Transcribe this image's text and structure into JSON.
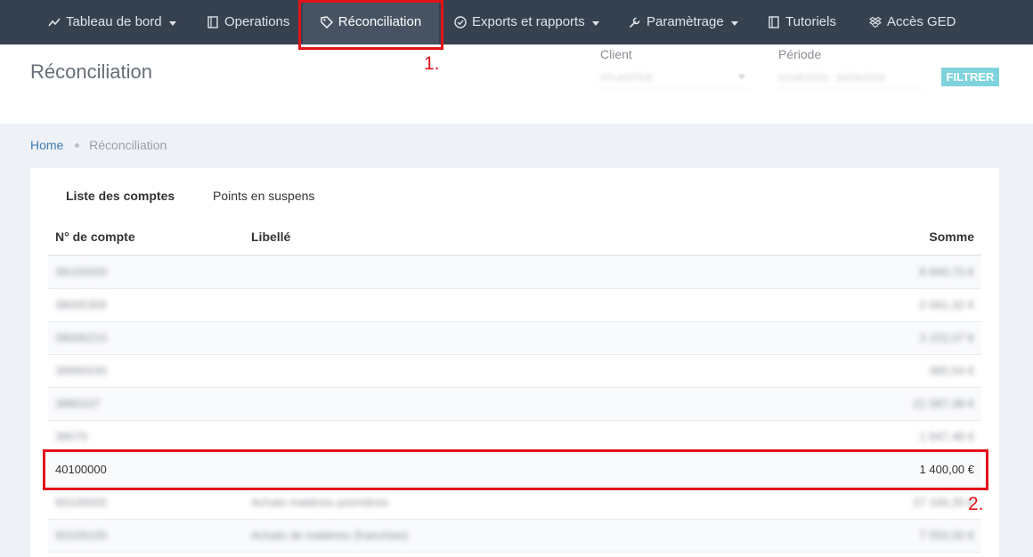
{
  "nav": {
    "items": [
      {
        "label": "Tableau de bord",
        "icon": "chart-line-icon",
        "caret": true
      },
      {
        "label": "Operations",
        "icon": "book-icon",
        "caret": false
      },
      {
        "label": "Réconciliation",
        "icon": "tag-icon",
        "caret": false,
        "active": true
      },
      {
        "label": "Exports et rapports",
        "icon": "check-circle-icon",
        "caret": true
      },
      {
        "label": "Paramètrage",
        "icon": "wrench-icon",
        "caret": true
      },
      {
        "label": "Tutoriels",
        "icon": "book-icon",
        "caret": false
      },
      {
        "label": "Accès GED",
        "icon": "dropbox-icon",
        "caret": false
      }
    ]
  },
  "page": {
    "title": "Réconciliation"
  },
  "filters": {
    "client_label": "Client",
    "client_value": "ATLANTIDE",
    "period_label": "Période",
    "period_value": "01/08/2023 - 30/08/2024",
    "button_label": "FILTRER"
  },
  "breadcrumb": {
    "home": "Home",
    "current": "Réconciliation"
  },
  "tabs": [
    {
      "label": "Liste des comptes",
      "active": true
    },
    {
      "label": "Points en suspens",
      "active": false
    }
  ],
  "table": {
    "columns": [
      "N° de compte",
      "Libellé",
      "Somme"
    ],
    "rows": [
      {
        "account": "38100000",
        "label": "",
        "amount": "8 840,73 €",
        "blurred": true
      },
      {
        "account": "38005300",
        "label": "",
        "amount": "2 091,32 €",
        "blurred": true
      },
      {
        "account": "38006210",
        "label": "",
        "amount": "3 152,07 €",
        "blurred": true
      },
      {
        "account": "38990030",
        "label": "",
        "amount": "380,54 €",
        "blurred": true
      },
      {
        "account": "3880107",
        "label": "",
        "amount": "21 087,38 €",
        "blurred": true
      },
      {
        "account": "38070",
        "label": "",
        "amount": "1 847,48 €",
        "blurred": true
      },
      {
        "account": "40100000",
        "label": "",
        "amount": "1 400,00 €",
        "blurred": false
      },
      {
        "account": "60100000",
        "label": "Achats matières premières",
        "amount": "27 166,35 €",
        "blurred": true
      },
      {
        "account": "60109100",
        "label": "Achats de matières (franchise)",
        "amount": "7 550,00 €",
        "blurred": true
      }
    ]
  },
  "annotations": {
    "first": "1.",
    "second": "2."
  },
  "colors": {
    "navbar": "#364150",
    "accent": "#3d7fb7",
    "filter_button": "#7fd3dd",
    "annotation": "#e3131a"
  }
}
